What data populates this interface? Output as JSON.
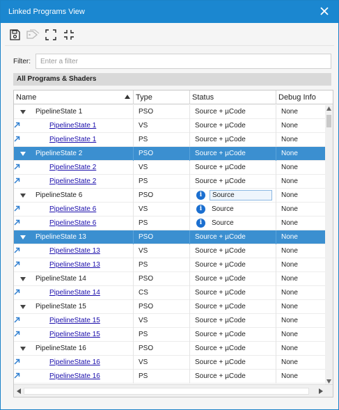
{
  "window": {
    "title": "Linked Programs View"
  },
  "toolbar": {
    "buttons": [
      {
        "icon": "save-icon"
      },
      {
        "icon": "tag-icon"
      },
      {
        "icon": "expand-icon"
      },
      {
        "icon": "collapse-icon"
      }
    ]
  },
  "filter": {
    "label": "Filter:",
    "value": "",
    "placeholder": "Enter a filter"
  },
  "group": {
    "title": "All Programs & Shaders"
  },
  "columns": [
    "Name",
    "Type",
    "Status",
    "Debug Info"
  ],
  "colors": {
    "titlebar": "#1b87d0",
    "selection": "#3b8fd0",
    "link": "#1a0dab",
    "info": "#1b6fd0"
  },
  "rows": [
    {
      "kind": "parent",
      "name": "PipelineState 1",
      "type": "PSO",
      "status": "Source + µCode",
      "debug": "None",
      "selected": false,
      "info": false
    },
    {
      "kind": "child",
      "name": "PipelineState 1",
      "type": "VS",
      "status": "Source + µCode",
      "debug": "None",
      "selected": false,
      "info": false
    },
    {
      "kind": "child",
      "name": "PipelineState 1",
      "type": "PS",
      "status": "Source + µCode",
      "debug": "None",
      "selected": false,
      "info": false
    },
    {
      "kind": "parent",
      "name": "PipelineState 2",
      "type": "PSO",
      "status": "Source + µCode",
      "debug": "None",
      "selected": true,
      "info": false
    },
    {
      "kind": "child",
      "name": "PipelineState 2",
      "type": "VS",
      "status": "Source + µCode",
      "debug": "None",
      "selected": false,
      "info": false
    },
    {
      "kind": "child",
      "name": "PipelineState 2",
      "type": "PS",
      "status": "Source + µCode",
      "debug": "None",
      "selected": false,
      "info": false
    },
    {
      "kind": "parent",
      "name": "PipelineState 6",
      "type": "PSO",
      "status": "Source",
      "debug": "None",
      "selected": false,
      "info": true,
      "boxed": true
    },
    {
      "kind": "child",
      "name": "PipelineState 6",
      "type": "VS",
      "status": "Source",
      "debug": "None",
      "selected": false,
      "info": true
    },
    {
      "kind": "child",
      "name": "PipelineState 6",
      "type": "PS",
      "status": "Source",
      "debug": "None",
      "selected": false,
      "info": true
    },
    {
      "kind": "parent",
      "name": "PipelineState 13",
      "type": "PSO",
      "status": "Source + µCode",
      "debug": "None",
      "selected": true,
      "info": false
    },
    {
      "kind": "child",
      "name": "PipelineState 13",
      "type": "VS",
      "status": "Source + µCode",
      "debug": "None",
      "selected": false,
      "info": false
    },
    {
      "kind": "child",
      "name": "PipelineState 13",
      "type": "PS",
      "status": "Source + µCode",
      "debug": "None",
      "selected": false,
      "info": false
    },
    {
      "kind": "parent",
      "name": "PipelineState 14",
      "type": "PSO",
      "status": "Source + µCode",
      "debug": "None",
      "selected": false,
      "info": false
    },
    {
      "kind": "child",
      "name": "PipelineState 14",
      "type": "CS",
      "status": "Source + µCode",
      "debug": "None",
      "selected": false,
      "info": false
    },
    {
      "kind": "parent",
      "name": "PipelineState 15",
      "type": "PSO",
      "status": "Source + µCode",
      "debug": "None",
      "selected": false,
      "info": false
    },
    {
      "kind": "child",
      "name": "PipelineState 15",
      "type": "VS",
      "status": "Source + µCode",
      "debug": "None",
      "selected": false,
      "info": false
    },
    {
      "kind": "child",
      "name": "PipelineState 15",
      "type": "PS",
      "status": "Source + µCode",
      "debug": "None",
      "selected": false,
      "info": false
    },
    {
      "kind": "parent",
      "name": "PipelineState 16",
      "type": "PSO",
      "status": "Source + µCode",
      "debug": "None",
      "selected": false,
      "info": false
    },
    {
      "kind": "child",
      "name": "PipelineState 16",
      "type": "VS",
      "status": "Source + µCode",
      "debug": "None",
      "selected": false,
      "info": false
    },
    {
      "kind": "child",
      "name": "PipelineState 16",
      "type": "PS",
      "status": "Source + µCode",
      "debug": "None",
      "selected": false,
      "info": false
    }
  ]
}
